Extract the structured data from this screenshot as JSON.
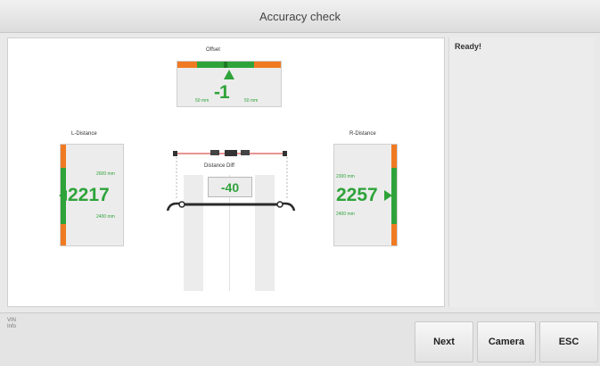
{
  "window": {
    "title": "Accuracy check"
  },
  "status": {
    "text": "Ready!"
  },
  "offset": {
    "label": "Offset",
    "value": "-1",
    "left_limit": "50 mm",
    "right_limit": "50 mm"
  },
  "left_distance": {
    "label": "L-Distance",
    "value": "2217",
    "upper_limit": "2600 mm",
    "lower_limit": "2400 mm"
  },
  "right_distance": {
    "label": "R-Distance",
    "value": "2257",
    "upper_limit": "2300 mm",
    "lower_limit": "2400 mm"
  },
  "distance_diff": {
    "label": "Distance Diff",
    "value": "-40"
  },
  "footer": {
    "info_line1": "VIN",
    "info_line2": "Info"
  },
  "buttons": {
    "next": "Next",
    "camera": "Camera",
    "esc": "ESC"
  },
  "colors": {
    "ok_green": "#2fa33a",
    "limit_orange": "#f07a22",
    "beam_red": "#d9534f"
  }
}
